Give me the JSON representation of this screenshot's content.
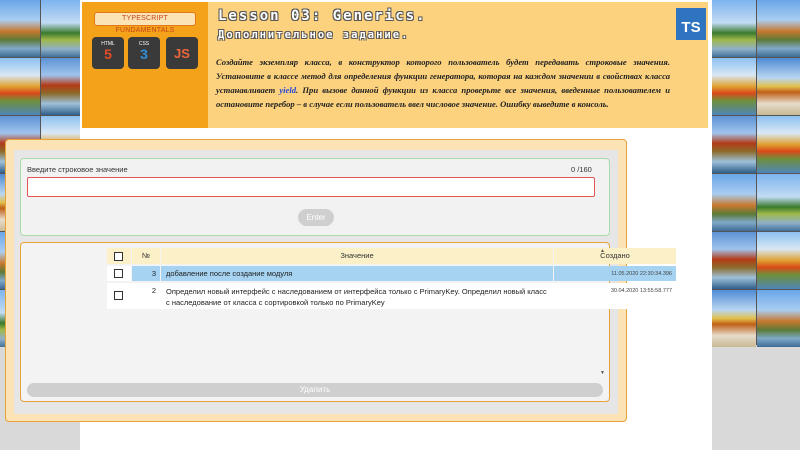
{
  "header": {
    "badge": "TYPESCRIPT FUNDAMENTALS",
    "tech": [
      {
        "small": "HTML",
        "big": "5"
      },
      {
        "small": "CSS",
        "big": "3"
      },
      {
        "big": "JS"
      }
    ],
    "lesson_title": "Lesson 03: Generics.",
    "lesson_subtitle": "Дополнительное задание.",
    "ts_logo": "TS",
    "desc_part1": "Создайте экземпляр класса, в конструктор которого пользователь будет передавать строковые значения. Установите в классе метод для определения функции генератора, которая на каждом значении в свойствах класса устанавливает ",
    "desc_keyword": "yield",
    "desc_part2": ". При вызове данной функции из класса проверьте все значения, введенные пользователем и остановите перебор – в случае если пользователь ввел числовое значение. Ошибку выведите в консоль."
  },
  "input": {
    "label": "Введите строковое значение",
    "counter": "0 /160",
    "value": "",
    "enter_label": "Enter"
  },
  "table": {
    "headers": {
      "num": "№",
      "value": "Значение",
      "created": "Создано"
    },
    "rows": [
      {
        "num": "3",
        "value": "добавление после создание модуля",
        "created": "11.05.2020 22:30:34.396",
        "selected": true
      },
      {
        "num": "2",
        "value": "Определил новый интерфейс с наследованием от интерфейса только с PrimaryKey. Определил новый класс с наследование от класса с сортировкой только по PrimaryKey",
        "created": "30.04.2020 13:55:58.777",
        "selected": false
      }
    ],
    "delete_label": "Удалить"
  },
  "colors": {
    "accent": "#f5a21b",
    "header_bg": "#fcd27e",
    "selected_row": "#a6d3f2",
    "ts_blue": "#2f74c0"
  }
}
